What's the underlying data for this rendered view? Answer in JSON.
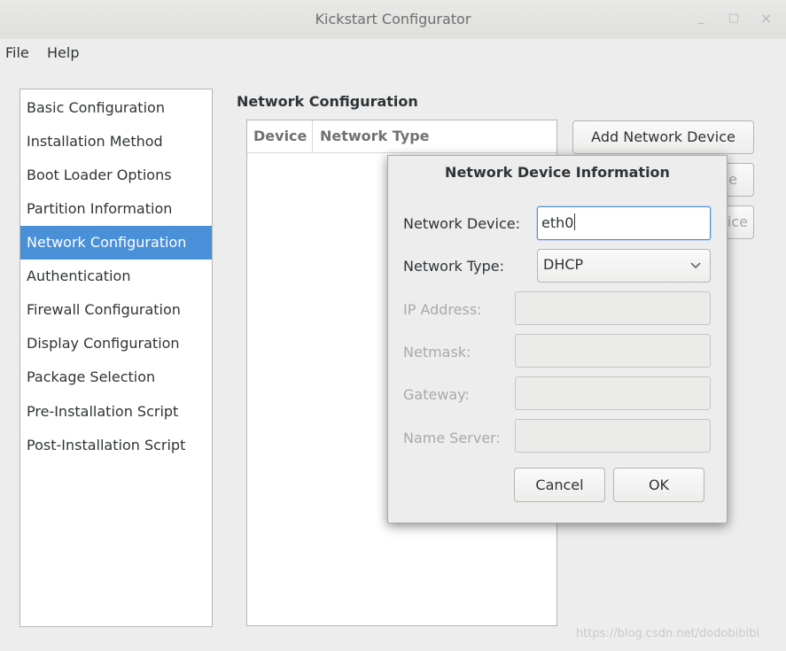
{
  "window": {
    "title": "Kickstart Configurator",
    "controls": {
      "minimize": "_",
      "maximize": "□",
      "close": "×"
    }
  },
  "menubar": {
    "items": [
      "File",
      "Help"
    ]
  },
  "sidebar": {
    "items": [
      {
        "label": "Basic Configuration",
        "selected": false
      },
      {
        "label": "Installation Method",
        "selected": false
      },
      {
        "label": "Boot Loader Options",
        "selected": false
      },
      {
        "label": "Partition Information",
        "selected": false
      },
      {
        "label": "Network Configuration",
        "selected": true
      },
      {
        "label": "Authentication",
        "selected": false
      },
      {
        "label": "Firewall Configuration",
        "selected": false
      },
      {
        "label": "Display Configuration",
        "selected": false
      },
      {
        "label": "Package Selection",
        "selected": false
      },
      {
        "label": "Pre-Installation Script",
        "selected": false
      },
      {
        "label": "Post-Installation Script",
        "selected": false
      }
    ]
  },
  "main": {
    "section_title": "Network Configuration",
    "table": {
      "columns": [
        "Device",
        "Network Type"
      ]
    },
    "buttons": {
      "add": "Add Network Device",
      "edit_partial": "e",
      "delete_partial": "ice"
    }
  },
  "dialog": {
    "title": "Network Device Information",
    "network_device": {
      "label": "Network Device:",
      "value": "eth0"
    },
    "network_type": {
      "label": "Network Type:",
      "value": "DHCP"
    },
    "ip_address": {
      "label": "IP Address:",
      "value": ""
    },
    "netmask": {
      "label": "Netmask:",
      "value": ""
    },
    "gateway": {
      "label": "Gateway:",
      "value": ""
    },
    "name_server": {
      "label": "Name Server:",
      "value": ""
    },
    "cancel": "Cancel",
    "ok": "OK"
  },
  "watermark": "https://blog.csdn.net/dodobibibi",
  "colors": {
    "selection": "#4a90d9",
    "background": "#ededed",
    "focus_border": "#4a90d9"
  }
}
